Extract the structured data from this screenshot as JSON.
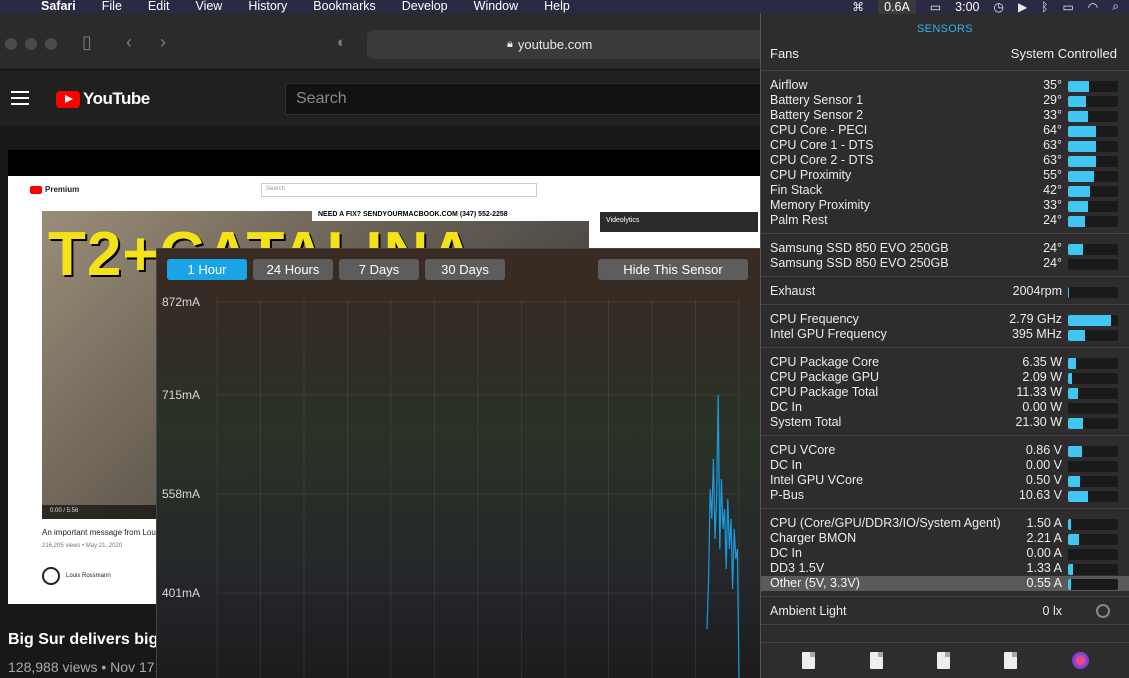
{
  "menubar": {
    "app": "Safari",
    "items": [
      "File",
      "Edit",
      "View",
      "History",
      "Bookmarks",
      "Develop",
      "Window",
      "Help"
    ],
    "amp_reading": "0.6A",
    "clock": "3:00"
  },
  "safari": {
    "url": "youtube.com"
  },
  "youtube": {
    "brand": "YouTube",
    "search_placeholder": "Search",
    "embedded": {
      "brand": "Premium",
      "search_placeholder": "Search",
      "thumb_title": "T2+CATALINA",
      "thumb_banner": "NEED A FIX? SENDYOURMACBOOK.COM  (347) 552-2258",
      "player_time": "0:00 / 5:56",
      "caption": "An important message from Lou",
      "meta": "216,205 views • May 21, 2020",
      "user": "Louis Rossmann",
      "sidebar_tool": "Videolytics"
    },
    "video_title": "Big Sur delivers big",
    "video_meta": "128,988 views • Nov 17,"
  },
  "graph": {
    "ranges": [
      "1 Hour",
      "24 Hours",
      "7 Days",
      "30 Days"
    ],
    "active_range": "1 Hour",
    "hide_label": "Hide This Sensor",
    "y_ticks": [
      "872mA",
      "715mA",
      "558mA",
      "401mA"
    ],
    "line_color": "#1a9be0"
  },
  "sensors": {
    "header": "SENSORS",
    "fans_label": "Fans",
    "fans_value": "System Controlled",
    "groups": [
      [
        {
          "label": "Airflow",
          "value": "35°",
          "level": 0.42
        },
        {
          "label": "Battery Sensor 1",
          "value": "29°",
          "level": 0.35
        },
        {
          "label": "Battery Sensor 2",
          "value": "33°",
          "level": 0.4
        },
        {
          "label": "CPU Core - PECI",
          "value": "64°",
          "level": 0.56
        },
        {
          "label": "CPU Core 1 - DTS",
          "value": "63°",
          "level": 0.55
        },
        {
          "label": "CPU Core 2 - DTS",
          "value": "63°",
          "level": 0.55
        },
        {
          "label": "CPU Proximity",
          "value": "55°",
          "level": 0.52
        },
        {
          "label": "Fin Stack",
          "value": "42°",
          "level": 0.44
        },
        {
          "label": "Memory Proximity",
          "value": "33°",
          "level": 0.4
        },
        {
          "label": "Palm Rest",
          "value": "24°",
          "level": 0.34
        }
      ],
      [
        {
          "label": "Samsung SSD 850 EVO 250GB",
          "value": "24°",
          "level": 0.3
        },
        {
          "label": "Samsung SSD 850 EVO 250GB",
          "value": "24°",
          "level": 0.0
        }
      ],
      [
        {
          "label": "Exhaust",
          "value": "2004rpm",
          "level": 0.02
        }
      ],
      [
        {
          "label": "CPU Frequency",
          "value": "2.79 GHz",
          "level": 0.86
        },
        {
          "label": "Intel GPU Frequency",
          "value": "395 MHz",
          "level": 0.34
        }
      ],
      [
        {
          "label": "CPU Package Core",
          "value": "6.35 W",
          "level": 0.16
        },
        {
          "label": "CPU Package GPU",
          "value": "2.09 W",
          "level": 0.08
        },
        {
          "label": "CPU Package Total",
          "value": "11.33 W",
          "level": 0.2
        },
        {
          "label": "DC In",
          "value": "0.00 W",
          "level": 0.0
        },
        {
          "label": "System Total",
          "value": "21.30 W",
          "level": 0.3
        }
      ],
      [
        {
          "label": "CPU VCore",
          "value": "0.86 V",
          "level": 0.28
        },
        {
          "label": "DC In",
          "value": "0.00 V",
          "level": 0.0
        },
        {
          "label": "Intel GPU VCore",
          "value": "0.50 V",
          "level": 0.24
        },
        {
          "label": "P-Bus",
          "value": "10.63 V",
          "level": 0.4
        }
      ],
      [
        {
          "label": "CPU (Core/GPU/DDR3/IO/System Agent)",
          "value": "1.50 A",
          "level": 0.06
        },
        {
          "label": "Charger BMON",
          "value": "2.21 A",
          "level": 0.22
        },
        {
          "label": "DC In",
          "value": "0.00 A",
          "level": 0.0
        },
        {
          "label": "DD3 1.5V",
          "value": "1.33 A",
          "level": 0.1
        },
        {
          "label": "Other (5V, 3.3V)",
          "value": "0.55 A",
          "level": 0.05,
          "highlight": true
        }
      ],
      [
        {
          "label": "Ambient Light",
          "value": "0 lx",
          "level": null
        }
      ]
    ]
  }
}
